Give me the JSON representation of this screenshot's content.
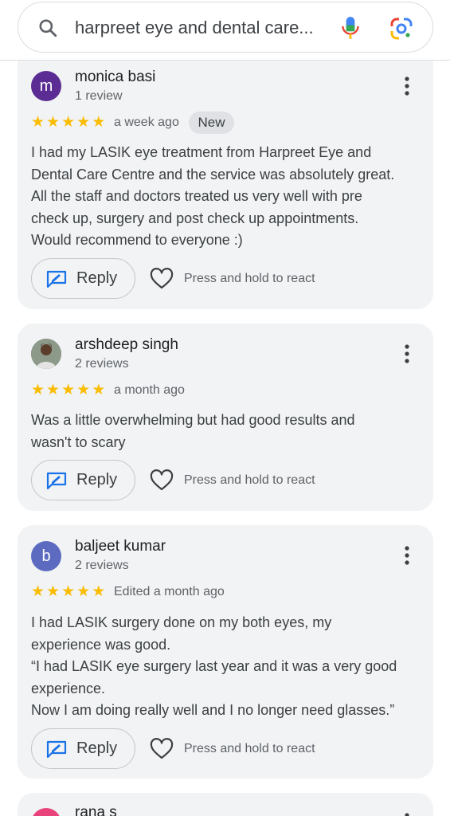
{
  "search": {
    "query": "harpreet eye and dental care...",
    "icons": {
      "search": "search-icon",
      "voice": "mic-icon",
      "lens": "google-lens-icon"
    }
  },
  "reviews": [
    {
      "initial": "m",
      "avatar_color": "#5b2c93",
      "name": "monica basi",
      "count": "1 review",
      "rating": 5,
      "when": "a week ago",
      "badge": "New",
      "text_lines": [
        "I had my LASIK eye treatment from Harpreet Eye and",
        "Dental Care Centre and the service was absolutely great.",
        "All the staff and doctors treated us very well with pre",
        "check up, surgery and post check up appointments.",
        "Would recommend to everyone :)"
      ],
      "reply_label": "Reply",
      "react_text": "Press and hold to react"
    },
    {
      "initial": "",
      "avatar_color": "#6b6b5c",
      "name": "arshdeep singh",
      "count": "2 reviews",
      "rating": 5,
      "when": "a month ago",
      "text_lines": [
        "Was a little overwhelming but had good results and",
        "wasn't to scary"
      ],
      "reply_label": "Reply",
      "react_text": "Press and hold to react"
    },
    {
      "initial": "b",
      "avatar_color": "#5c6bc0",
      "name": "baljeet kumar",
      "count": "2 reviews",
      "rating": 5,
      "when": "Edited a month ago",
      "text_lines": [
        "I had LASIK surgery done on my both eyes, my",
        "experience was good.",
        "“I had LASIK eye surgery last year and it was a very good",
        "experience.",
        "Now I am doing really well and I no longer need glasses.”"
      ],
      "reply_label": "Reply",
      "react_text": "Press and hold to react"
    },
    {
      "initial": "",
      "avatar_color": "#e8437a",
      "name": "rana s"
    }
  ],
  "colors": {
    "star": "#fbbc04",
    "reply_icon": "#1a73e8",
    "card_bg": "#f1f3f4"
  }
}
